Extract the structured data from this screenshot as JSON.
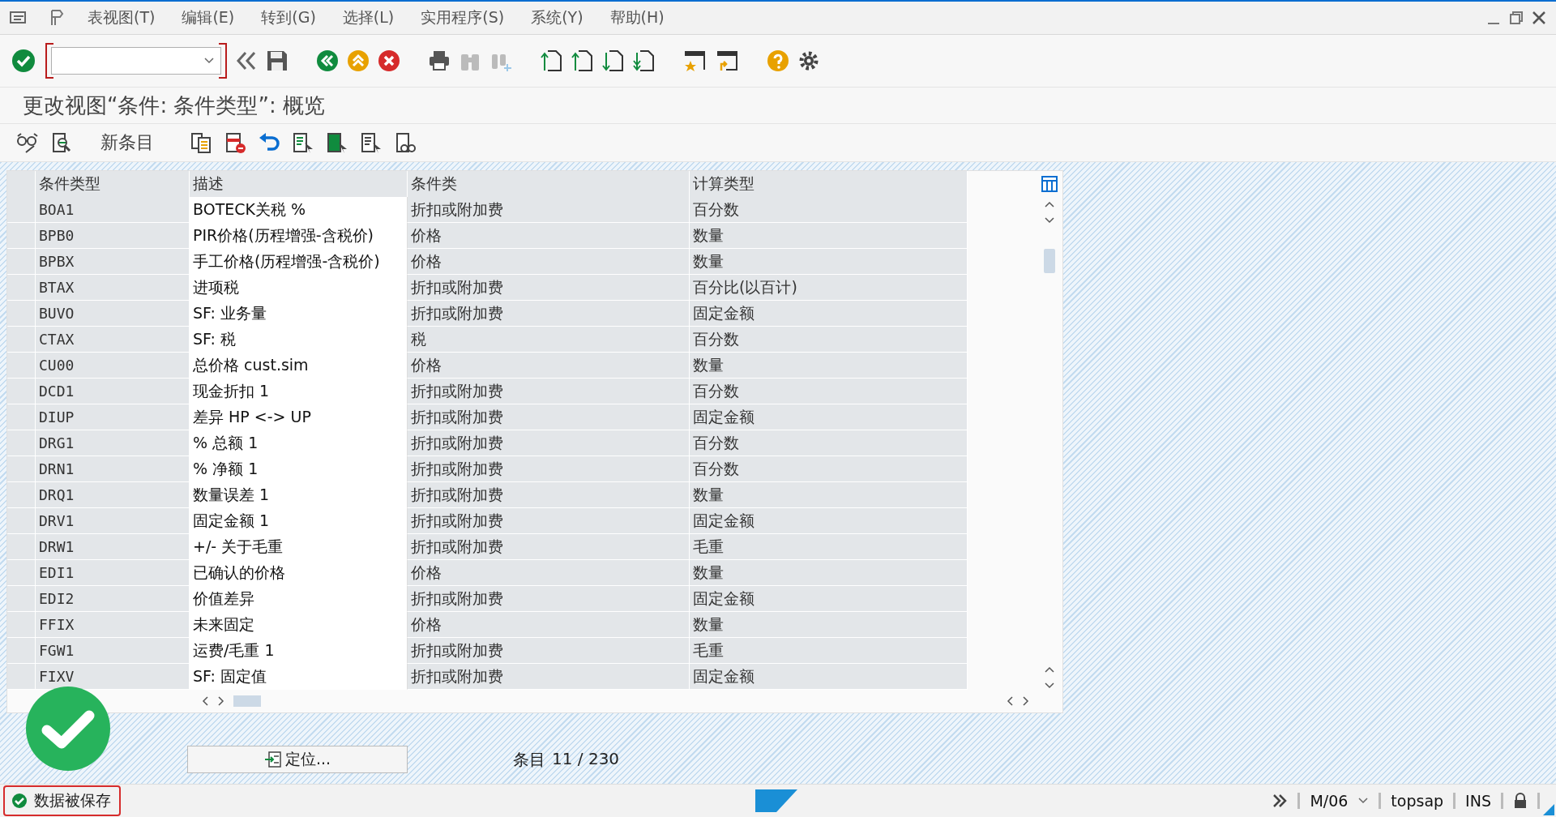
{
  "menu": [
    {
      "label": "表视图(T)"
    },
    {
      "label": "编辑(E)"
    },
    {
      "label": "转到(G)"
    },
    {
      "label": "选择(L)"
    },
    {
      "label": "实用程序(S)"
    },
    {
      "label": "系统(Y)"
    },
    {
      "label": "帮助(H)"
    }
  ],
  "title": "更改视图“条件: 条件类型”: 概览",
  "app_toolbar": {
    "new_entries": "新条目"
  },
  "table": {
    "columns": [
      "条件类型",
      "描述",
      "条件类",
      "计算类型"
    ],
    "rows": [
      [
        "BOA1",
        "BOTECK关税 %",
        "折扣或附加费",
        "百分数"
      ],
      [
        "BPB0",
        "PIR价格(历程增强-含税价)",
        "价格",
        "数量"
      ],
      [
        "BPBX",
        "手工价格(历程增强-含税价)",
        "价格",
        "数量"
      ],
      [
        "BTAX",
        "进项税",
        "折扣或附加费",
        "百分比(以百计)"
      ],
      [
        "BUVO",
        "SF: 业务量",
        "折扣或附加费",
        "固定金额"
      ],
      [
        "CTAX",
        "SF: 税",
        "税",
        "百分数"
      ],
      [
        "CU00",
        "总价格 cust.sim",
        "价格",
        "数量"
      ],
      [
        "DCD1",
        "现金折扣 1",
        "折扣或附加费",
        "百分数"
      ],
      [
        "DIUP",
        "差异 HP <-> UP",
        "折扣或附加费",
        "固定金额"
      ],
      [
        "DRG1",
        "% 总额 1",
        "折扣或附加费",
        "百分数"
      ],
      [
        "DRN1",
        "% 净额 1",
        "折扣或附加费",
        "百分数"
      ],
      [
        "DRQ1",
        "数量误差 1",
        "折扣或附加费",
        "数量"
      ],
      [
        "DRV1",
        "固定金额 1",
        "折扣或附加费",
        "固定金额"
      ],
      [
        "DRW1",
        "+/- 关于毛重",
        "折扣或附加费",
        "毛重"
      ],
      [
        "EDI1",
        "已确认的价格",
        "价格",
        "数量"
      ],
      [
        "EDI2",
        "价值差异",
        "折扣或附加费",
        "固定金额"
      ],
      [
        "FFIX",
        "未来固定",
        "价格",
        "数量"
      ],
      [
        "FGW1",
        "运费/毛重 1",
        "折扣或附加费",
        "毛重"
      ],
      [
        "FIXV",
        "SF: 固定值",
        "折扣或附加费",
        "固定金额"
      ]
    ]
  },
  "position_button": "定位...",
  "entry_label": "条目",
  "entry_count": "11 / 230",
  "status": {
    "message": "数据被保存",
    "system": "M/06",
    "client": "topsap",
    "mode": "INS"
  }
}
